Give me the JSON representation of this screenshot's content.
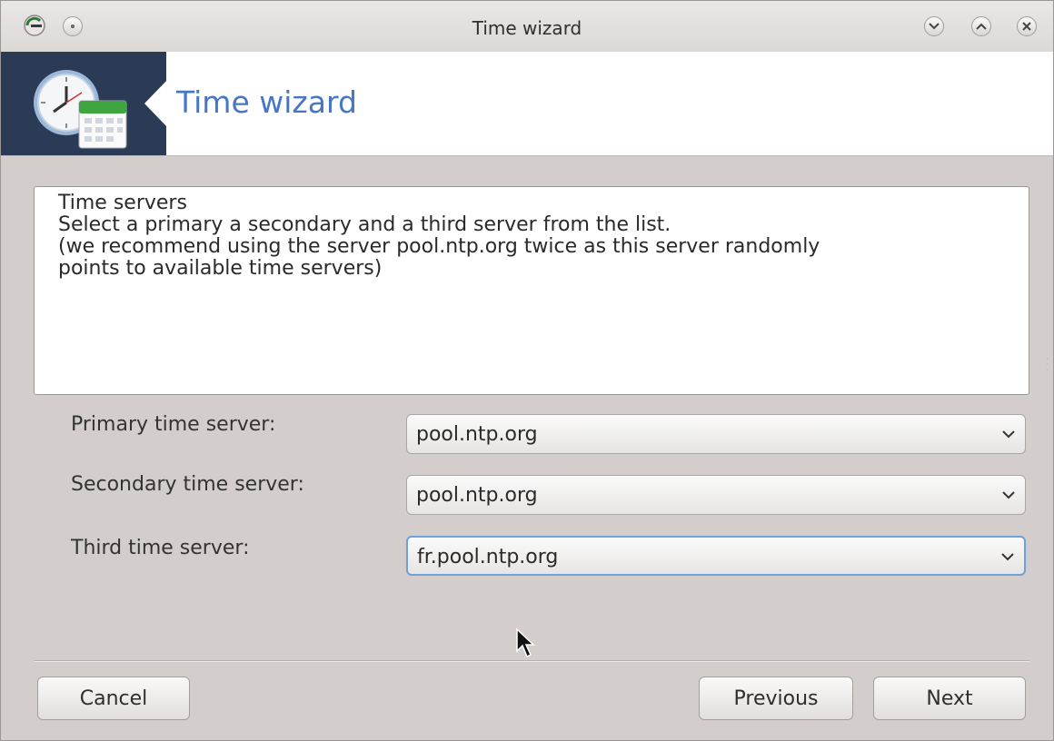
{
  "window": {
    "title": "Time wizard"
  },
  "titlebar_icons": {
    "app": "app-menu-icon",
    "sticky": "keep-above-icon",
    "minimize": "chevron-down-icon",
    "maximize": "chevron-up-icon",
    "close": "close-icon"
  },
  "banner": {
    "title": "Time wizard",
    "icon": "clock-calendar-icon"
  },
  "description": {
    "lines": [
      "Time servers",
      "Select a primary a secondary and a third server from the list.",
      "(we recommend using the server pool.ntp.org twice as this server randomly",
      "points to available time servers)"
    ]
  },
  "form": {
    "primary": {
      "label": "Primary time server:",
      "value": "pool.ntp.org"
    },
    "secondary": {
      "label": "Secondary time server:",
      "value": "pool.ntp.org"
    },
    "third": {
      "label": "Third time server:",
      "value": "fr.pool.ntp.org"
    }
  },
  "buttons": {
    "cancel": "Cancel",
    "previous": "Previous",
    "next": "Next"
  },
  "colors": {
    "accent": "#4577c5",
    "banner_dark": "#2b3a55",
    "focus": "#6ea0dc"
  }
}
